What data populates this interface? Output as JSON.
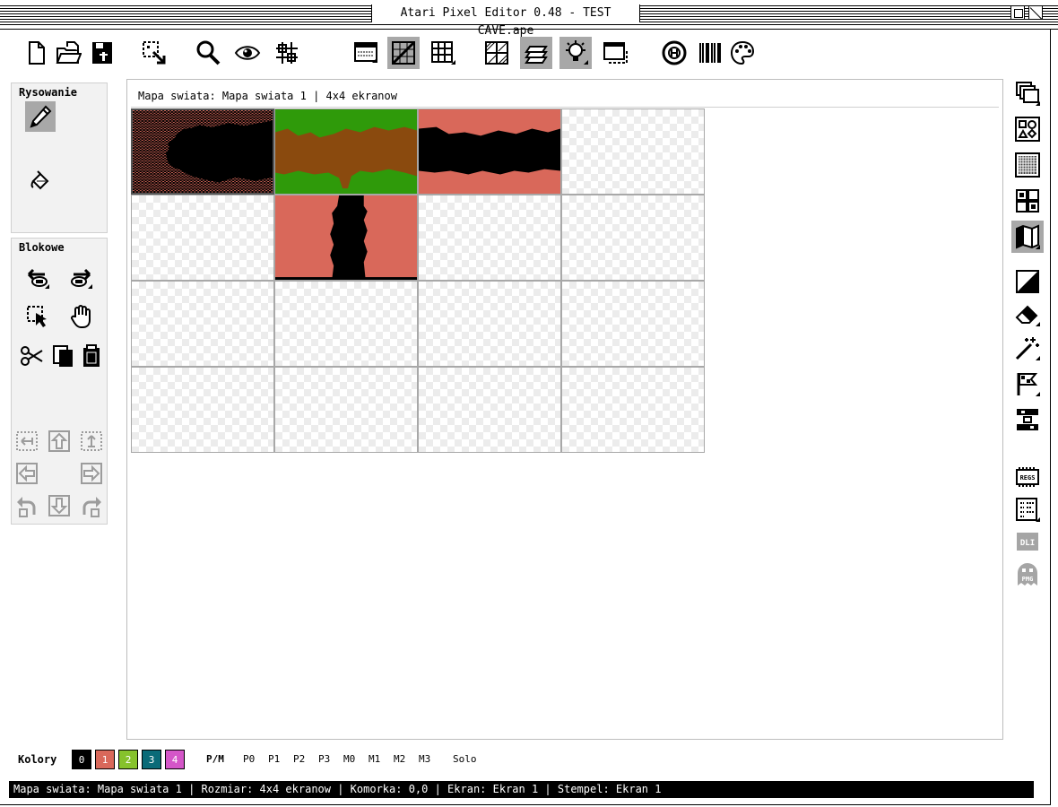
{
  "window": {
    "title": "Atari Pixel Editor 0.48 - TEST CAVE.ape"
  },
  "toolbar": {
    "buttons": [
      {
        "icon": "new-file-icon",
        "active": false
      },
      {
        "icon": "open-folder-icon",
        "active": false
      },
      {
        "icon": "save-icon",
        "active": false
      },
      {
        "icon": "select-resize-icon",
        "active": false
      },
      {
        "icon": "magnifier-icon",
        "active": false
      },
      {
        "icon": "eye-icon",
        "active": false
      },
      {
        "icon": "pattern-grid-icon",
        "active": false
      },
      {
        "icon": "screen-window-icon",
        "active": false
      },
      {
        "icon": "diagonal-grid-icon",
        "active": true
      },
      {
        "icon": "grid-icon",
        "active": false
      },
      {
        "icon": "hatched-grid-icon",
        "active": false
      },
      {
        "icon": "layers-icon",
        "active": true
      },
      {
        "icon": "lightbulb-icon",
        "active": true
      },
      {
        "icon": "dashed-window-icon",
        "active": false
      },
      {
        "icon": "help-lifebuoy-icon",
        "active": false
      },
      {
        "icon": "barcode-icon",
        "active": false
      },
      {
        "icon": "palette-icon",
        "active": false
      }
    ]
  },
  "panels": {
    "drawing": {
      "title": "Rysowanie"
    },
    "block": {
      "title": "Blokowe"
    }
  },
  "map": {
    "header": "Mapa swiata: Mapa swiata 1 | 4x4 ekranow",
    "cols": 4,
    "rows": 4,
    "cells": [
      {
        "row": 0,
        "col": 0,
        "thumb": "cave-pink"
      },
      {
        "row": 0,
        "col": 1,
        "thumb": "grass-dirt"
      },
      {
        "row": 0,
        "col": 2,
        "thumb": "tunnel-salmon"
      },
      {
        "row": 1,
        "col": 1,
        "thumb": "shaft-salmon"
      }
    ],
    "selected": {
      "row": 0,
      "col": 0
    }
  },
  "colors": {
    "label": "Kolory",
    "swatches": [
      {
        "label": "0",
        "color": "#000000"
      },
      {
        "label": "1",
        "color": "#d9685a"
      },
      {
        "label": "2",
        "color": "#86c22c"
      },
      {
        "label": "3",
        "color": "#0a6b78"
      },
      {
        "label": "4",
        "color": "#d456c8"
      }
    ],
    "pm_label": "P/M",
    "pm_items": [
      "P0",
      "P1",
      "P2",
      "P3",
      "M0",
      "M1",
      "M2",
      "M3"
    ],
    "solo_label": "Solo"
  },
  "status": {
    "text": "Mapa swiata: Mapa swiata 1 | Rozmiar: 4x4 ekranow | Komorka: 0,0 | Ekran: Ekran 1 | Stempel: Ekran 1"
  },
  "palette": {
    "salmon": "#d9685a",
    "grass": "#2f9a0a",
    "dirt": "#8a4a0e",
    "active_bg": "#a8a8a8"
  }
}
